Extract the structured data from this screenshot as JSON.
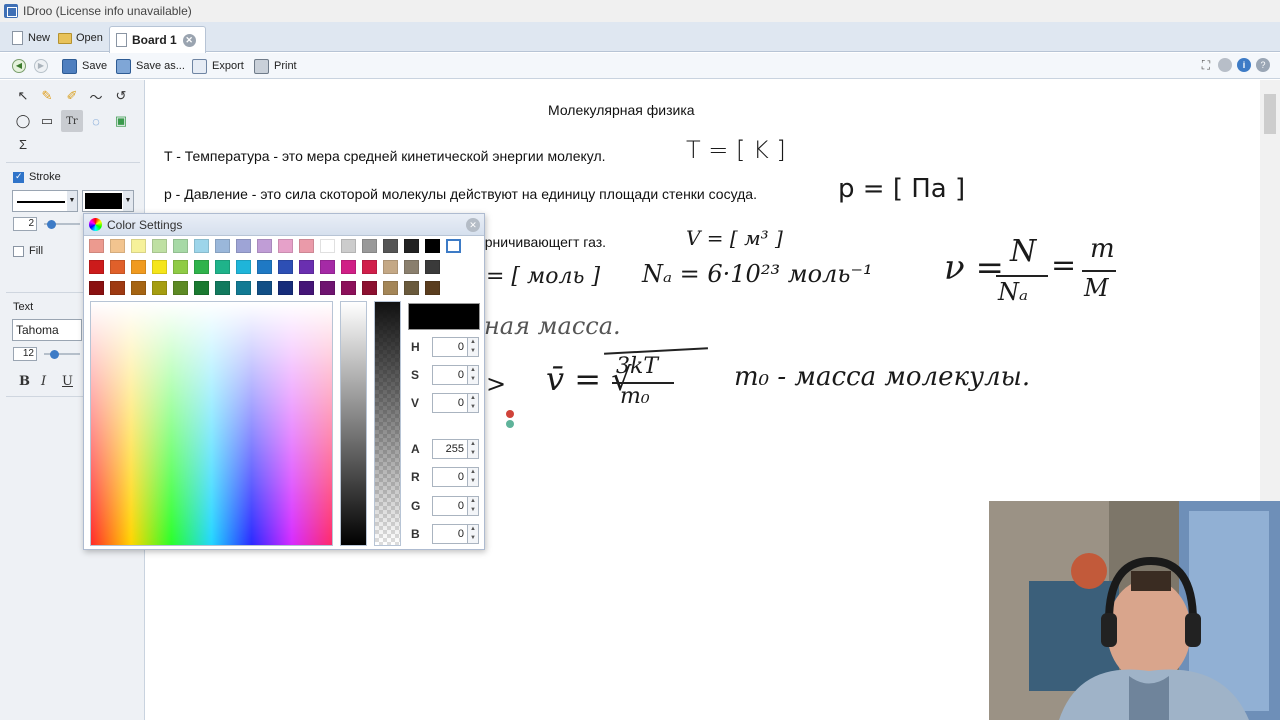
{
  "window": {
    "title": "IDroo (License info unavailable)"
  },
  "tabs": {
    "new_label": "New",
    "open_label": "Open",
    "board_label": "Board 1"
  },
  "toolbar": {
    "save_label": "Save",
    "save_as_label": "Save as...",
    "export_label": "Export",
    "print_label": "Print"
  },
  "left_panel": {
    "stroke_label": "Stroke",
    "stroke_checked": true,
    "stroke_width": "2",
    "fill_label": "Fill",
    "fill_checked": false,
    "text_label": "Text",
    "font_name": "Tahoma",
    "font_size": "12",
    "bold_label": "B",
    "italic_label": "I",
    "underline_label": "U",
    "sigma_label": "Σ",
    "text_tool_label": "Tr",
    "stroke_color": "#000000"
  },
  "board": {
    "heading": "Молекулярная физика",
    "line1": "T - Температура - это мера средней кинетической энергии молекул.",
    "line2": "p - Давление - это сила скоторой молекулы действуют на единицу площади стенки сосуда.",
    "line3_visible": "да огрничивающегт газ.",
    "hand_T": "T = [ K ]",
    "hand_p": "p = [ Па ]",
    "hand_V": "V = [ м³ ]",
    "hand_mol": "= [ моль ]",
    "hand_NA": "Nₐ = 6·10²³ моль⁻¹",
    "hand_nu_lhs": "ν =",
    "hand_nu_N": "N",
    "hand_nu_NA": "Nₐ",
    "hand_eq": "=",
    "hand_nu_m": "m",
    "hand_nu_M": "M",
    "hand_mass": "ная масса.",
    "hand_arrow": ">",
    "hand_v": "v̄ = √",
    "hand_3kT": "3kT",
    "hand_m0": "m₀",
    "hand_m0_desc": "m₀ - масса молекулы."
  },
  "color_dialog": {
    "title": "Color Settings",
    "h_label": "H",
    "h_value": "0",
    "s_label": "S",
    "s_value": "0",
    "v_label": "V",
    "v_value": "0",
    "a_label": "A",
    "a_value": "255",
    "r_label": "R",
    "r_value": "0",
    "g_label": "G",
    "g_value": "0",
    "b_label": "B",
    "b_value": "0",
    "current_color": "#000000",
    "swatches_row1": [
      "#ec9a8f",
      "#f2c48f",
      "#f6f19a",
      "#bfe0a3",
      "#a7d9a6",
      "#9dd5ea",
      "#9ab7da",
      "#9ea4d6",
      "#c09dd6",
      "#e6a1c9",
      "#ea9aa9",
      "#ffffff",
      "#cccccc",
      "#999999",
      "#555555",
      "#222222",
      "#000000",
      "#ffffff"
    ],
    "swatches_row2": [
      "#cc1b1b",
      "#e0602a",
      "#f09a1f",
      "#f5e51a",
      "#8fcb45",
      "#2fb34b",
      "#1fb38a",
      "#1fb5d9",
      "#1f79c4",
      "#2d4fb5",
      "#6a2fb0",
      "#a52aa6",
      "#d01f86",
      "#d01f4a",
      "#c4a885",
      "#8a7f6d",
      "#3a3a3a"
    ],
    "swatches_row3": [
      "#8a1010",
      "#9e3a12",
      "#a56412",
      "#a59d10",
      "#5d8a24",
      "#1a7a30",
      "#127a5e",
      "#127a93",
      "#124f86",
      "#162c7a",
      "#451577",
      "#6f1470",
      "#8c105a",
      "#8c1030",
      "#a48657",
      "#6a5a3c",
      "#5a3d1e"
    ]
  },
  "colors": {
    "accent": "#3d7bc6",
    "panel": "#eef1f5",
    "tabbar": "#dfe7f1"
  }
}
